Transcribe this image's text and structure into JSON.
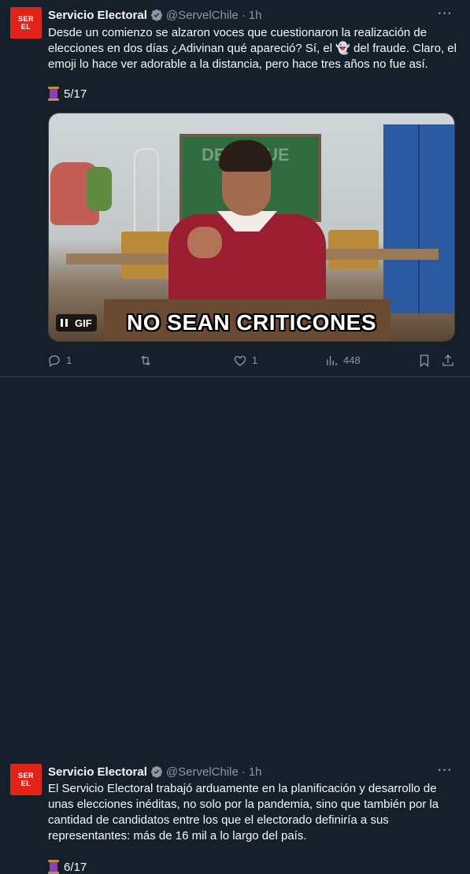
{
  "tweets": [
    {
      "avatar_text_1": "SER",
      "avatar_text_2": "EL",
      "name": "Servicio Electoral",
      "handle": "@ServelChile",
      "separator": "·",
      "time": "1h",
      "more": "···",
      "text": "Desde un comienzo se alzaron voces que cuestionaron la realización de elecciones en dos días ¿Adivinan qué apareció? Sí, el 👻 del fraude. Claro, el emoji lo hace ver adorable a la distancia, pero hace tres años no fue así.",
      "thread_count": "5/17",
      "media": {
        "caption": "NO SEAN CRITICONES",
        "badge": "GIF",
        "board_text_1": "DE",
        "board_text_2": "QUE"
      },
      "actions": {
        "replies": "1",
        "retweets": "",
        "likes": "1",
        "views": "448"
      }
    },
    {
      "avatar_text_1": "SER",
      "avatar_text_2": "EL",
      "name": "Servicio Electoral",
      "handle": "@ServelChile",
      "separator": "·",
      "time": "1h",
      "more": "···",
      "text": "El Servicio Electoral trabajó arduamente en la planificación y desarrollo de unas elecciones inéditas, no solo por la pandemia, sino que también por la cantidad de candidatos entre los que el electorado definiría a sus representantes: más de 16 mil a lo largo del país.",
      "thread_count": "6/17"
    }
  ],
  "colors": {
    "background": "#15202b",
    "text": "#f7f9f9",
    "muted": "#8b98a5",
    "verified": "#1d9bf0",
    "brand": "#e2231a"
  },
  "icons": [
    "verified-badge-icon",
    "more-icon",
    "spool-icon",
    "reply-icon",
    "retweet-icon",
    "like-icon",
    "views-icon",
    "bookmark-icon",
    "share-icon",
    "pause-icon"
  ]
}
